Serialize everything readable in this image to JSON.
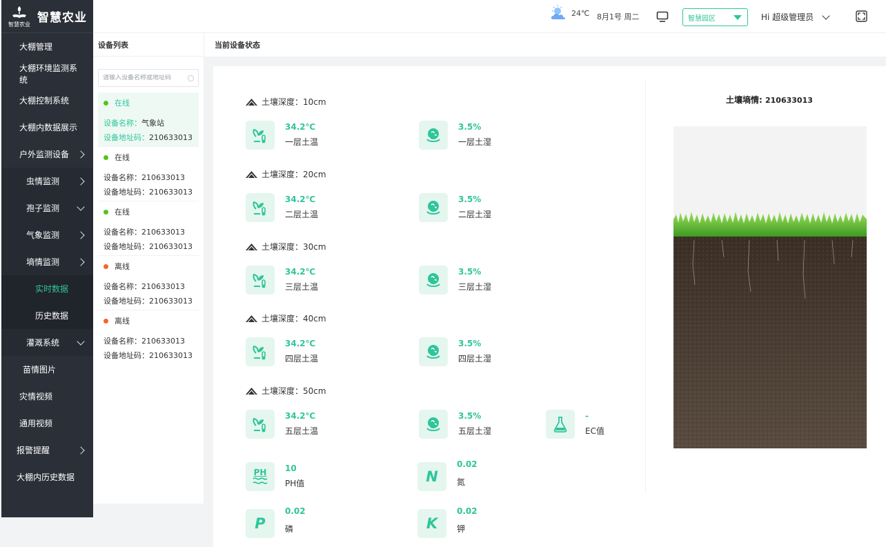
{
  "app": {
    "title": "智慧农业",
    "logo_small": "智慧农业"
  },
  "sidebar": {
    "items": [
      {
        "label": "大棚管理"
      },
      {
        "label": "大棚环境监测系统"
      },
      {
        "label": "大棚控制系统"
      },
      {
        "label": "大棚内数据展示"
      },
      {
        "label": "户外监测设备"
      },
      {
        "label": "虫情监测"
      },
      {
        "label": "孢子监测"
      },
      {
        "label": "气象监测"
      },
      {
        "label": "墒情监测"
      },
      {
        "label": "实时数据"
      },
      {
        "label": "历史数据"
      },
      {
        "label": "灌溉系统"
      },
      {
        "label": "苗情图片"
      },
      {
        "label": "灾情视频"
      },
      {
        "label": "通用视频"
      },
      {
        "label": "报警提醒"
      },
      {
        "label": "大棚内历史数据"
      }
    ]
  },
  "header": {
    "weather_temp": "24℃",
    "date": "8月1号 周二",
    "park_selected": "智慧园区",
    "user": "Hi 超级管理员"
  },
  "device_list": {
    "title": "设备列表",
    "search_placeholder": "请输入设备名称或地址码",
    "devices": [
      {
        "status": "在线",
        "name_label": "设备名称：",
        "name": "气象站",
        "addr_label": "设备地址码：",
        "addr": "210633013"
      },
      {
        "status": "在线",
        "name_label": "设备名称：",
        "name": "210633013",
        "addr_label": "设备地址码：",
        "addr": "210633013"
      },
      {
        "status": "在线",
        "name_label": "设备名称：",
        "name": "210633013",
        "addr_label": "设备地址码：",
        "addr": "210633013"
      },
      {
        "status": "离线",
        "name_label": "设备名称：",
        "name": "210633013",
        "addr_label": "设备地址码：",
        "addr": "210633013"
      },
      {
        "status": "离线",
        "name_label": "设备名称：",
        "name": "210633013",
        "addr_label": "设备地址码：",
        "addr": "210633013"
      }
    ]
  },
  "status_panel": {
    "title": "当前设备状态",
    "depths": [
      {
        "label": "土壤深度：10cm",
        "temp_value": "34.2℃",
        "temp_label": "一层土温",
        "hum_value": "3.5%",
        "hum_label": "一层土湿"
      },
      {
        "label": "土壤深度：20cm",
        "temp_value": "34.2℃",
        "temp_label": "二层土温",
        "hum_value": "3.5%",
        "hum_label": "二层土湿"
      },
      {
        "label": "土壤深度：30cm",
        "temp_value": "34.2℃",
        "temp_label": "三层土温",
        "hum_value": "3.5%",
        "hum_label": "三层土湿"
      },
      {
        "label": "土壤深度：40cm",
        "temp_value": "34.2℃",
        "temp_label": "四层土温",
        "hum_value": "3.5%",
        "hum_label": "四层土湿"
      },
      {
        "label": "土壤深度：50cm",
        "temp_value": "34.2℃",
        "temp_label": "五层土温",
        "hum_value": "3.5%",
        "hum_label": "五层土湿"
      }
    ],
    "ec": {
      "value": "-",
      "label": "EC值"
    },
    "ph": {
      "value": "10",
      "label": "PH值",
      "icon_text": "PH"
    },
    "n": {
      "value": "0.02",
      "label": "氮",
      "letter": "N"
    },
    "p": {
      "value": "0.02",
      "label": "磷",
      "letter": "P"
    },
    "k": {
      "value": "0.02",
      "label": "钾",
      "letter": "K"
    },
    "soil_title": "土壤墒情",
    "soil_id": "210633013"
  },
  "colors": {
    "accent": "#2fc59a",
    "sidebar_bg": "#2a2f38",
    "online": "#52c41a",
    "offline": "#f5642a"
  }
}
